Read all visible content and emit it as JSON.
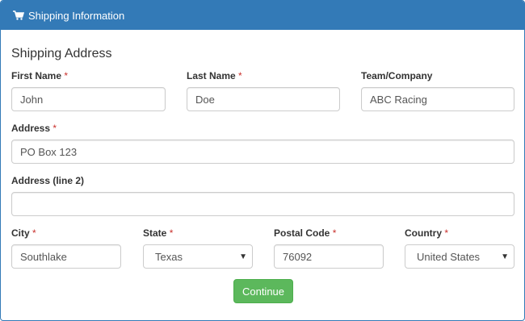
{
  "panel": {
    "heading": "Shipping Information",
    "heading_icon": "shopping-cart-icon"
  },
  "form": {
    "section_title": "Shipping Address",
    "required_marker": "*",
    "first_name": {
      "label": "First Name",
      "value": "John"
    },
    "last_name": {
      "label": "Last Name",
      "value": "Doe"
    },
    "team": {
      "label": "Team/Company",
      "value": "ABC Racing"
    },
    "address": {
      "label": "Address",
      "value": "PO Box 123"
    },
    "address2": {
      "label": "Address (line 2)",
      "value": ""
    },
    "city": {
      "label": "City",
      "value": "Southlake"
    },
    "state": {
      "label": "State",
      "value": "Texas"
    },
    "postal": {
      "label": "Postal Code",
      "value": "76092"
    },
    "country": {
      "label": "Country",
      "value": "United States"
    },
    "continue_label": "Continue"
  },
  "colors": {
    "primary": "#337ab7",
    "success": "#5cb85c",
    "required": "#c9302c"
  }
}
